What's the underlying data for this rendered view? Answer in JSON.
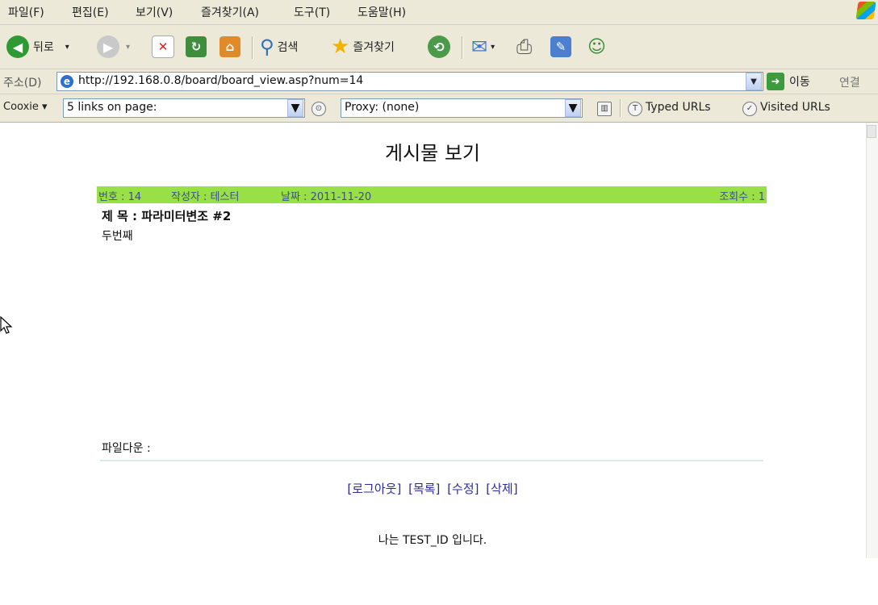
{
  "menubar": {
    "items": [
      "파일(F)",
      "편집(E)",
      "보기(V)",
      "즐겨찾기(A)",
      "도구(T)",
      "도움말(H)"
    ]
  },
  "toolbar": {
    "back_label": "뒤로",
    "search_label": "검색",
    "favorites_label": "즐겨찾기"
  },
  "address_bar": {
    "label": "주소(D)",
    "url": "http://192.168.0.8/board/board_view.asp?num=14",
    "go_label": "이동",
    "links_label": "연결"
  },
  "cookie_bar": {
    "cookie_label": "Cooxie",
    "links_field": "5 links on page:",
    "proxy_field": "Proxy: (none)",
    "typed_urls": "Typed URLs",
    "visited_urls": "Visited URLs"
  },
  "page": {
    "title": "게시물 보기",
    "info": {
      "number": "번호 : 14",
      "author": "작성자 : 테스터",
      "date": "날짜 : 2011-11-20",
      "views": "조회수 : 1"
    },
    "subject": "제 목 : 파라미터변조 #2",
    "body": "두번째",
    "download_label": "파일다운 :",
    "actions": [
      "[로그아웃]",
      "[목록]",
      "[수정]",
      "[삭제]"
    ],
    "footer_message": "나는 TEST_ID 입니다."
  },
  "colors": {
    "info_bar": "#99e046",
    "info_text": "#3b4f8a",
    "link": "#2b2b9c",
    "chrome": "#ece9d8"
  }
}
